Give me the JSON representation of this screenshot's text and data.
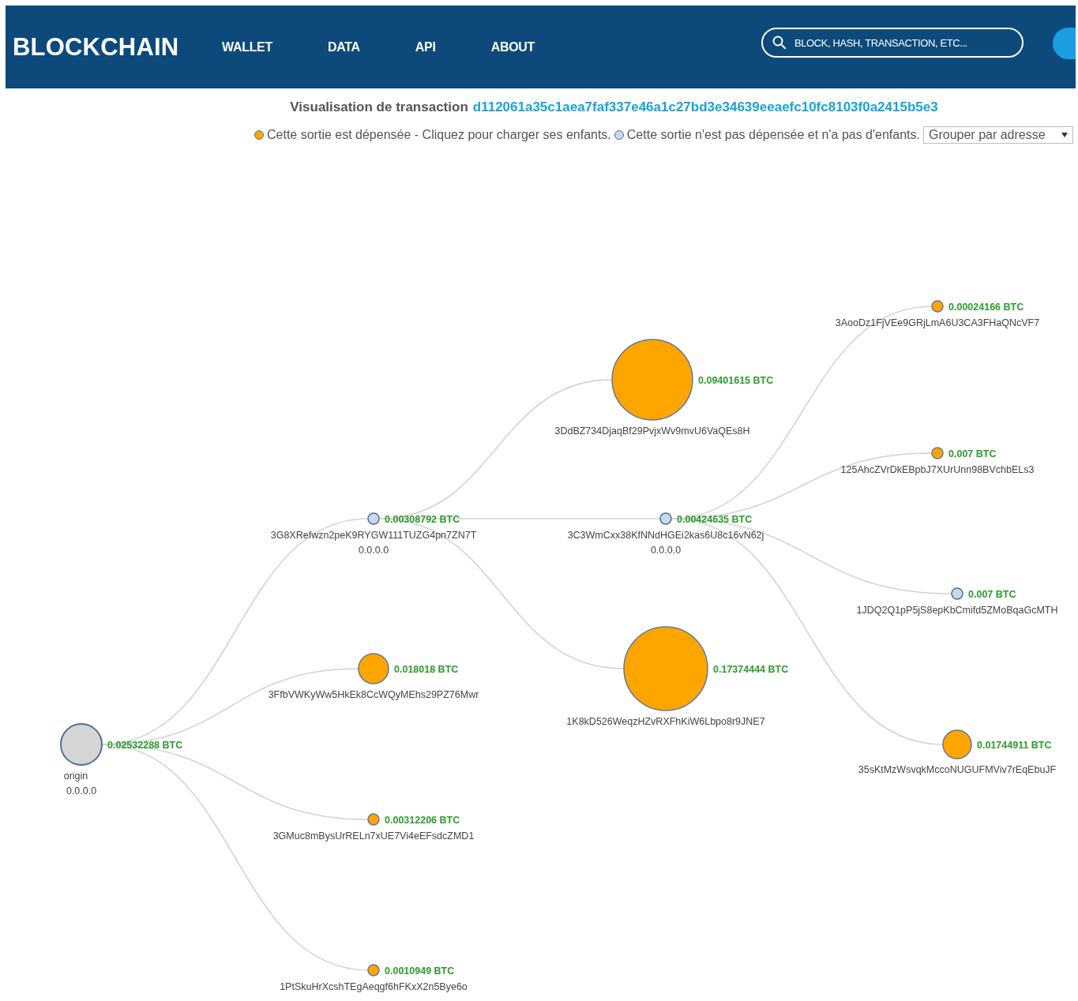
{
  "header": {
    "logo": "BLOCKCHAIN",
    "nav": [
      {
        "label": "WALLET"
      },
      {
        "label": "DATA"
      },
      {
        "label": "API"
      },
      {
        "label": "ABOUT"
      }
    ],
    "search": {
      "placeholder": "BLOCK, HASH, TRANSACTION, ETC..."
    }
  },
  "title": {
    "label": "Visualisation de transaction",
    "hash": "d112061a35c1aea7faf337e46a1c27bd3e34639eeaefc10fc8103f0a2415b5e3"
  },
  "legend": {
    "items": [
      {
        "spent": true,
        "text": "Cette sortie est dépensée - Cliquez pour charger ses enfants."
      },
      {
        "spent": false,
        "text": "Cette sortie n'est pas dépensée et n'a pas d'enfants."
      }
    ],
    "group_select": {
      "value": "Grouper par adresse"
    }
  },
  "graph": {
    "root": {
      "kind": "origin",
      "label": "origin",
      "ip": "0.0.0.0",
      "amount": "0.02532288 BTC",
      "children": [
        {
          "kind": "output",
          "spent": false,
          "label": "3G8XRefwzn2peK9RYGW111TUZG4pn7ZN7T",
          "ip": "0.0.0.0",
          "amount": "0.00308792 BTC",
          "children": [
            {
              "kind": "output",
              "spent": true,
              "label": "3DdBZ734DjaqBf29PvjxWv9mvU6VaQEs8H",
              "amount": "0.09401615 BTC"
            },
            {
              "kind": "output",
              "spent": false,
              "label": "3C3WmCxx38KfNNdHGEi2kas6U8c16vN62j",
              "ip": "0.0.0.0",
              "amount": "0.00424635 BTC",
              "children": [
                {
                  "kind": "output",
                  "spent": true,
                  "label": "3AooDz1FjVEe9GRjLmA6U3CA3FHaQNcVF7",
                  "amount": "0.00024166 BTC"
                },
                {
                  "kind": "output",
                  "spent": true,
                  "label": "125AhcZVrDkEBpbJ7XUrUnn98BVchbELs3",
                  "amount": "0.007 BTC"
                },
                {
                  "kind": "output",
                  "spent": false,
                  "label": "1JDQ2Q1pP5jS8epKbCmifd5ZMoBqaGcMTH",
                  "amount": "0.007 BTC"
                },
                {
                  "kind": "output",
                  "spent": true,
                  "label": "35sKtMzWsvqkMccoNUGUFMViv7rEqEbuJF",
                  "amount": "0.01744911 BTC"
                }
              ]
            },
            {
              "kind": "output",
              "spent": true,
              "label": "1K8kD526WeqzHZvRXFhKiW6Lbpo8r9JNE7",
              "amount": "0.17374444 BTC"
            }
          ]
        },
        {
          "kind": "output",
          "spent": true,
          "label": "3FfbVWKyWw5HkEk8CcWQyMEhs29PZ76Mwr",
          "amount": "0.018018 BTC"
        },
        {
          "kind": "output",
          "spent": true,
          "label": "3GMuc8mBysUrRELn7xUE7Vi4eEFsdcZMD1",
          "amount": "0.00312206 BTC"
        },
        {
          "kind": "output",
          "spent": true,
          "label": "1PtSkuHrXcshTEgAeqgf6hFKxX2n5Bye6o",
          "amount": "0.0010949 BTC"
        }
      ]
    }
  }
}
